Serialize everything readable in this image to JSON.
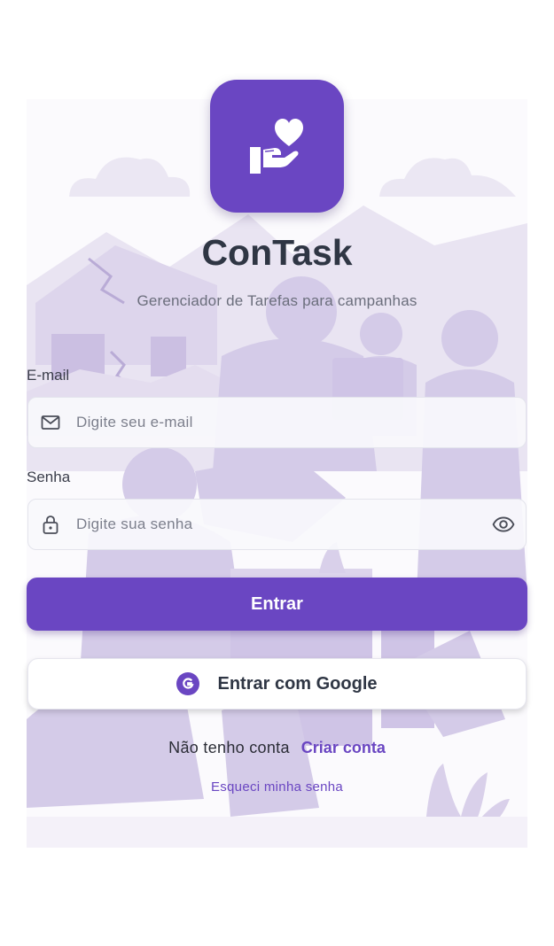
{
  "app": {
    "title": "ConTask",
    "subtitle": "Gerenciador de Tarefas para campanhas",
    "logo_icon": "heart-in-hand-icon"
  },
  "email": {
    "label": "E-mail",
    "placeholder": "Digite seu e-mail",
    "value": "",
    "icon": "mail-icon"
  },
  "password": {
    "label": "Senha",
    "placeholder": "Digite sua senha",
    "value": "",
    "icon": "lock-icon",
    "toggle_icon": "eye-icon"
  },
  "actions": {
    "login_label": "Entrar",
    "google_label": "Entrar com Google",
    "google_badge": "G"
  },
  "footer": {
    "no_account_text": "Não tenho conta",
    "create_account_label": "Criar conta",
    "forgot_password_label": "Esqueci minha senha"
  },
  "colors": {
    "primary": "#6a46c2",
    "title_text": "#2f3644",
    "illustration": "#d4cbe8"
  }
}
